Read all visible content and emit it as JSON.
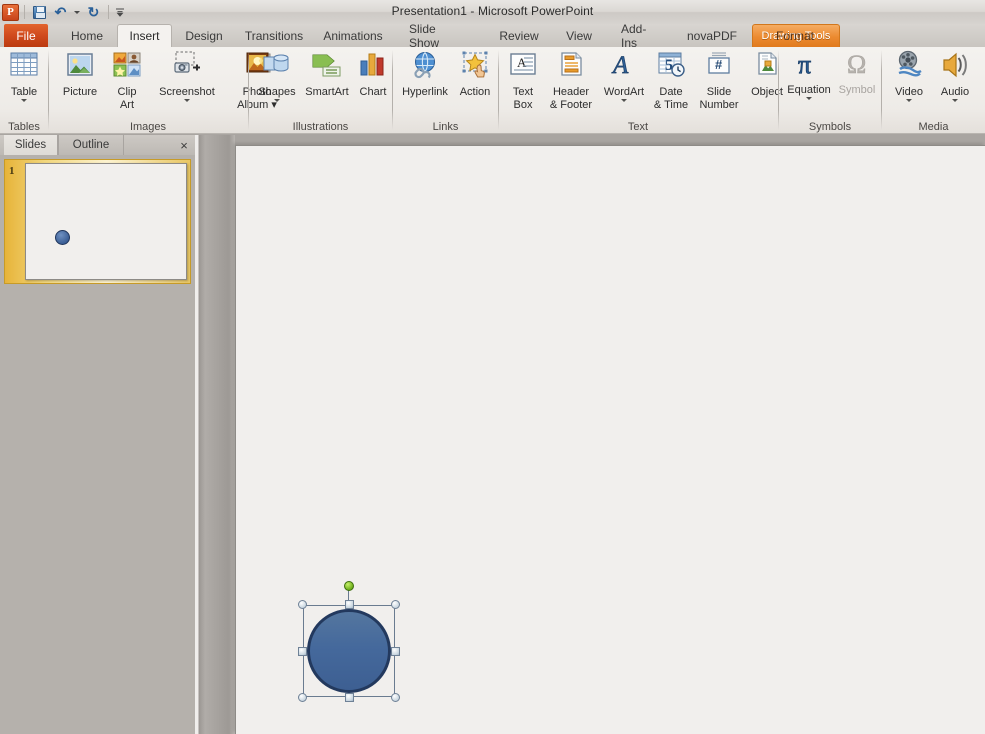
{
  "window": {
    "title": "Presentation1  -  Microsoft PowerPoint",
    "logo_label": "P"
  },
  "quick_access": {
    "items": [
      {
        "name": "save-icon",
        "label": "Save"
      },
      {
        "name": "undo-icon",
        "label": "Undo",
        "glyph": "↶"
      },
      {
        "name": "redo-icon",
        "label": "Redo",
        "glyph": "↻"
      },
      {
        "name": "customize-qat-icon",
        "label": "Customize Quick Access Toolbar"
      }
    ]
  },
  "tabs": {
    "file": "File",
    "items": [
      {
        "label": "Home",
        "active": false
      },
      {
        "label": "Insert",
        "active": true
      },
      {
        "label": "Design",
        "active": false
      },
      {
        "label": "Transitions",
        "active": false
      },
      {
        "label": "Animations",
        "active": false
      },
      {
        "label": "Slide Show",
        "active": false
      },
      {
        "label": "Review",
        "active": false
      },
      {
        "label": "View",
        "active": false
      },
      {
        "label": "Add-Ins",
        "active": false
      },
      {
        "label": "novaPDF",
        "active": false
      }
    ],
    "contextual": {
      "header": "Drawing Tools",
      "tab": "Format",
      "color": "#e8912f"
    }
  },
  "ribbon": {
    "groups": [
      {
        "name": "tables",
        "label": "Tables",
        "buttons": [
          {
            "name": "table-button",
            "label_line1": "Table",
            "label_line2": "",
            "dropdown": true,
            "icon": "table-icon"
          }
        ]
      },
      {
        "name": "images",
        "label": "Images",
        "buttons": [
          {
            "name": "picture-button",
            "label_line1": "Picture",
            "label_line2": "",
            "dropdown": false,
            "icon": "picture-icon"
          },
          {
            "name": "clip-art-button",
            "label_line1": "Clip",
            "label_line2": "Art",
            "dropdown": false,
            "icon": "clip-art-icon"
          },
          {
            "name": "screenshot-button",
            "label_line1": "Screenshot",
            "label_line2": "",
            "dropdown": true,
            "icon": "screenshot-icon"
          },
          {
            "name": "photo-album-button",
            "label_line1": "Photo",
            "label_line2": "Album ▾",
            "dropdown": false,
            "icon": "photo-album-icon"
          }
        ]
      },
      {
        "name": "illustrations",
        "label": "Illustrations",
        "buttons": [
          {
            "name": "shapes-button",
            "label_line1": "Shapes",
            "label_line2": "",
            "dropdown": true,
            "icon": "shapes-icon"
          },
          {
            "name": "smartart-button",
            "label_line1": "SmartArt",
            "label_line2": "",
            "dropdown": false,
            "icon": "smartart-icon"
          },
          {
            "name": "chart-button",
            "label_line1": "Chart",
            "label_line2": "",
            "dropdown": false,
            "icon": "chart-icon"
          }
        ]
      },
      {
        "name": "links",
        "label": "Links",
        "buttons": [
          {
            "name": "hyperlink-button",
            "label_line1": "Hyperlink",
            "label_line2": "",
            "dropdown": false,
            "icon": "hyperlink-icon"
          },
          {
            "name": "action-button",
            "label_line1": "Action",
            "label_line2": "",
            "dropdown": false,
            "icon": "action-icon"
          }
        ]
      },
      {
        "name": "text",
        "label": "Text",
        "buttons": [
          {
            "name": "text-box-button",
            "label_line1": "Text",
            "label_line2": "Box",
            "dropdown": false,
            "icon": "text-box-icon"
          },
          {
            "name": "header-footer-button",
            "label_line1": "Header",
            "label_line2": "& Footer",
            "dropdown": false,
            "icon": "header-footer-icon"
          },
          {
            "name": "wordart-button",
            "label_line1": "WordArt",
            "label_line2": "",
            "dropdown": true,
            "icon": "wordart-icon"
          },
          {
            "name": "date-time-button",
            "label_line1": "Date",
            "label_line2": "& Time",
            "dropdown": false,
            "icon": "date-time-icon"
          },
          {
            "name": "slide-number-button",
            "label_line1": "Slide",
            "label_line2": "Number",
            "dropdown": false,
            "icon": "slide-number-icon"
          },
          {
            "name": "object-button",
            "label_line1": "Object",
            "label_line2": "",
            "dropdown": false,
            "icon": "object-icon"
          }
        ]
      },
      {
        "name": "symbols",
        "label": "Symbols",
        "buttons": [
          {
            "name": "equation-button",
            "label_line1": "Equation",
            "label_line2": "",
            "dropdown": true,
            "icon": "pi-icon",
            "disabled": false
          },
          {
            "name": "symbol-button",
            "label_line1": "Symbol",
            "label_line2": "",
            "dropdown": false,
            "icon": "omega-icon",
            "disabled": true
          }
        ]
      },
      {
        "name": "media",
        "label": "Media",
        "buttons": [
          {
            "name": "video-button",
            "label_line1": "Video",
            "label_line2": "",
            "dropdown": true,
            "icon": "video-icon"
          },
          {
            "name": "audio-button",
            "label_line1": "Audio",
            "label_line2": "",
            "dropdown": true,
            "icon": "audio-icon"
          }
        ]
      }
    ]
  },
  "left_panel": {
    "tabs": [
      {
        "name": "slides-tab",
        "label": "Slides",
        "active": true
      },
      {
        "name": "outline-tab",
        "label": "Outline",
        "active": false
      }
    ],
    "close_label": "×",
    "slides": [
      {
        "number": "1",
        "selected": true
      }
    ]
  },
  "slide": {
    "shape": {
      "name": "oval-shape",
      "type": "circle",
      "fill_color": "#41659F",
      "outline_color": "#23395E",
      "selected": true,
      "rotation_handle_color": "#74B320",
      "handle_count": 8
    }
  }
}
